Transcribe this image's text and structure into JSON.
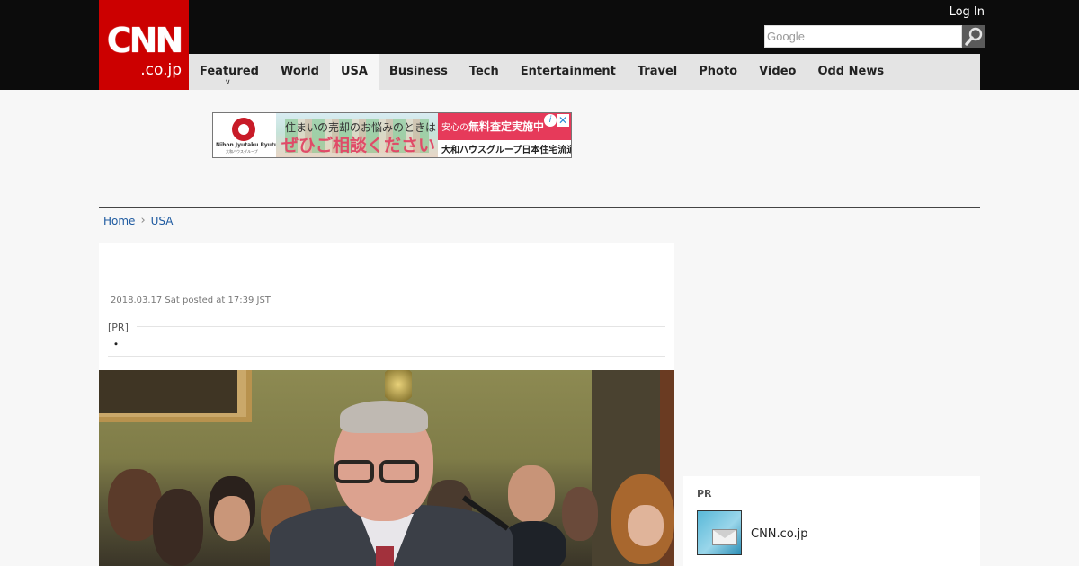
{
  "header": {
    "logo_main": "CNN",
    "logo_sub": ".co.jp",
    "login_label": "Log In",
    "search_placeholder": "Google"
  },
  "nav": {
    "items": [
      {
        "label": "Featured",
        "active": false,
        "has_dropdown": true
      },
      {
        "label": "World",
        "active": false
      },
      {
        "label": "USA",
        "active": true
      },
      {
        "label": "Business",
        "active": false
      },
      {
        "label": "Tech",
        "active": false
      },
      {
        "label": "Entertainment",
        "active": false
      },
      {
        "label": "Travel",
        "active": false
      },
      {
        "label": "Photo",
        "active": false
      },
      {
        "label": "Video",
        "active": false
      },
      {
        "label": "Odd News",
        "active": false
      }
    ]
  },
  "ad": {
    "brand": "Nihon Jyutaku Ryutu.",
    "brand_sub": "大和ハウスグループ",
    "line1": "住まいの売却のお悩みのときは",
    "line2": "ぜひご相談ください",
    "badge_small": "安心の",
    "badge_text": "無料査定実施中",
    "footer": "大和ハウスグループ日本住宅流通へ"
  },
  "breadcrumb": {
    "home": "Home",
    "current": "USA"
  },
  "article": {
    "date": "2018.03.17 Sat posted at 17:39 JST",
    "pr_label": "[PR]",
    "pr_text": "・"
  },
  "sidebar": {
    "pr_title": "PR",
    "pr_item": "CNN.co.jp"
  },
  "colors": {
    "brand_red": "#cc0000",
    "topbar": "#0c0c0c",
    "nav_bg": "#e4e4e4",
    "link": "#1e5aa0"
  }
}
